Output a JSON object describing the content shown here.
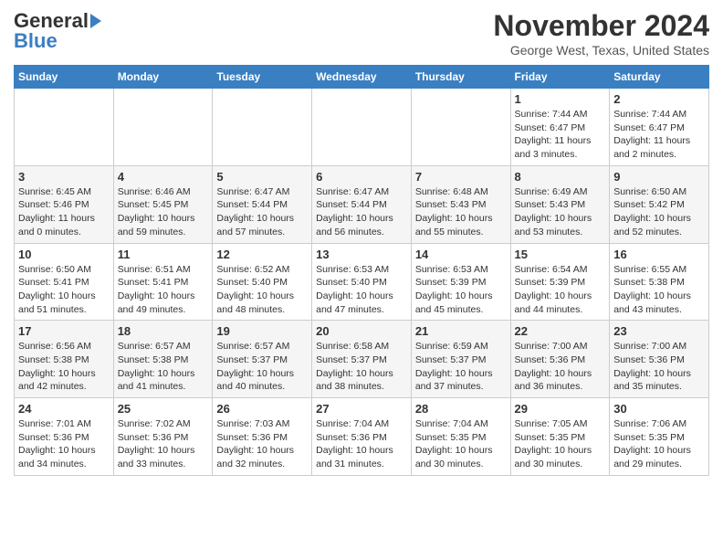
{
  "header": {
    "logo_general": "General",
    "logo_blue": "Blue",
    "month": "November 2024",
    "location": "George West, Texas, United States"
  },
  "days_of_week": [
    "Sunday",
    "Monday",
    "Tuesday",
    "Wednesday",
    "Thursday",
    "Friday",
    "Saturday"
  ],
  "weeks": [
    [
      {
        "day": "",
        "info": ""
      },
      {
        "day": "",
        "info": ""
      },
      {
        "day": "",
        "info": ""
      },
      {
        "day": "",
        "info": ""
      },
      {
        "day": "",
        "info": ""
      },
      {
        "day": "1",
        "info": "Sunrise: 7:44 AM\nSunset: 6:47 PM\nDaylight: 11 hours\nand 3 minutes."
      },
      {
        "day": "2",
        "info": "Sunrise: 7:44 AM\nSunset: 6:47 PM\nDaylight: 11 hours\nand 2 minutes."
      }
    ],
    [
      {
        "day": "3",
        "info": "Sunrise: 6:45 AM\nSunset: 5:46 PM\nDaylight: 11 hours\nand 0 minutes."
      },
      {
        "day": "4",
        "info": "Sunrise: 6:46 AM\nSunset: 5:45 PM\nDaylight: 10 hours\nand 59 minutes."
      },
      {
        "day": "5",
        "info": "Sunrise: 6:47 AM\nSunset: 5:44 PM\nDaylight: 10 hours\nand 57 minutes."
      },
      {
        "day": "6",
        "info": "Sunrise: 6:47 AM\nSunset: 5:44 PM\nDaylight: 10 hours\nand 56 minutes."
      },
      {
        "day": "7",
        "info": "Sunrise: 6:48 AM\nSunset: 5:43 PM\nDaylight: 10 hours\nand 55 minutes."
      },
      {
        "day": "8",
        "info": "Sunrise: 6:49 AM\nSunset: 5:43 PM\nDaylight: 10 hours\nand 53 minutes."
      },
      {
        "day": "9",
        "info": "Sunrise: 6:50 AM\nSunset: 5:42 PM\nDaylight: 10 hours\nand 52 minutes."
      }
    ],
    [
      {
        "day": "10",
        "info": "Sunrise: 6:50 AM\nSunset: 5:41 PM\nDaylight: 10 hours\nand 51 minutes."
      },
      {
        "day": "11",
        "info": "Sunrise: 6:51 AM\nSunset: 5:41 PM\nDaylight: 10 hours\nand 49 minutes."
      },
      {
        "day": "12",
        "info": "Sunrise: 6:52 AM\nSunset: 5:40 PM\nDaylight: 10 hours\nand 48 minutes."
      },
      {
        "day": "13",
        "info": "Sunrise: 6:53 AM\nSunset: 5:40 PM\nDaylight: 10 hours\nand 47 minutes."
      },
      {
        "day": "14",
        "info": "Sunrise: 6:53 AM\nSunset: 5:39 PM\nDaylight: 10 hours\nand 45 minutes."
      },
      {
        "day": "15",
        "info": "Sunrise: 6:54 AM\nSunset: 5:39 PM\nDaylight: 10 hours\nand 44 minutes."
      },
      {
        "day": "16",
        "info": "Sunrise: 6:55 AM\nSunset: 5:38 PM\nDaylight: 10 hours\nand 43 minutes."
      }
    ],
    [
      {
        "day": "17",
        "info": "Sunrise: 6:56 AM\nSunset: 5:38 PM\nDaylight: 10 hours\nand 42 minutes."
      },
      {
        "day": "18",
        "info": "Sunrise: 6:57 AM\nSunset: 5:38 PM\nDaylight: 10 hours\nand 41 minutes."
      },
      {
        "day": "19",
        "info": "Sunrise: 6:57 AM\nSunset: 5:37 PM\nDaylight: 10 hours\nand 40 minutes."
      },
      {
        "day": "20",
        "info": "Sunrise: 6:58 AM\nSunset: 5:37 PM\nDaylight: 10 hours\nand 38 minutes."
      },
      {
        "day": "21",
        "info": "Sunrise: 6:59 AM\nSunset: 5:37 PM\nDaylight: 10 hours\nand 37 minutes."
      },
      {
        "day": "22",
        "info": "Sunrise: 7:00 AM\nSunset: 5:36 PM\nDaylight: 10 hours\nand 36 minutes."
      },
      {
        "day": "23",
        "info": "Sunrise: 7:00 AM\nSunset: 5:36 PM\nDaylight: 10 hours\nand 35 minutes."
      }
    ],
    [
      {
        "day": "24",
        "info": "Sunrise: 7:01 AM\nSunset: 5:36 PM\nDaylight: 10 hours\nand 34 minutes."
      },
      {
        "day": "25",
        "info": "Sunrise: 7:02 AM\nSunset: 5:36 PM\nDaylight: 10 hours\nand 33 minutes."
      },
      {
        "day": "26",
        "info": "Sunrise: 7:03 AM\nSunset: 5:36 PM\nDaylight: 10 hours\nand 32 minutes."
      },
      {
        "day": "27",
        "info": "Sunrise: 7:04 AM\nSunset: 5:36 PM\nDaylight: 10 hours\nand 31 minutes."
      },
      {
        "day": "28",
        "info": "Sunrise: 7:04 AM\nSunset: 5:35 PM\nDaylight: 10 hours\nand 30 minutes."
      },
      {
        "day": "29",
        "info": "Sunrise: 7:05 AM\nSunset: 5:35 PM\nDaylight: 10 hours\nand 30 minutes."
      },
      {
        "day": "30",
        "info": "Sunrise: 7:06 AM\nSunset: 5:35 PM\nDaylight: 10 hours\nand 29 minutes."
      }
    ]
  ]
}
